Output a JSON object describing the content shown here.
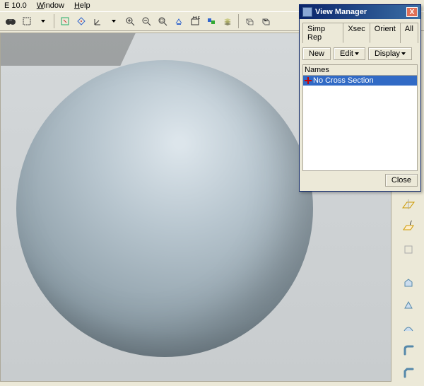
{
  "menu": {
    "version": "E 10.0",
    "window": "Window",
    "help": "Help"
  },
  "dialog": {
    "title": "View Manager",
    "tabs": {
      "simprep": "Simp Rep",
      "xsec": "Xsec",
      "orient": "Orient",
      "all": "All"
    },
    "buttons": {
      "new": "New",
      "edit": "Edit",
      "display": "Display"
    },
    "list_header": "Names",
    "items": [
      "No Cross Section"
    ],
    "close": "Close"
  }
}
